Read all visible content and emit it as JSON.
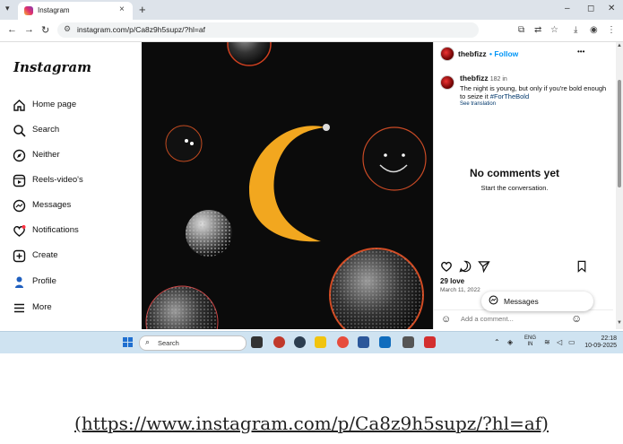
{
  "browser": {
    "tab_title": "Instagram",
    "tab_close": "×",
    "new_tab": "+",
    "address": "instagram.com/p/Ca8z9h5supz/?hl=af",
    "window_controls": [
      "–",
      "◻",
      "✕"
    ]
  },
  "sidebar": {
    "logo": "Instagram",
    "items": [
      {
        "label": "Home page",
        "icon": "home-icon"
      },
      {
        "label": "Search",
        "icon": "search-icon"
      },
      {
        "label": "Neither",
        "icon": "compass-icon"
      },
      {
        "label": "Reels-video's",
        "icon": "reels-icon"
      },
      {
        "label": "Messages",
        "icon": "messenger-icon"
      },
      {
        "label": "Notifications",
        "icon": "heart-icon"
      },
      {
        "label": "Create",
        "icon": "plus-square-icon"
      },
      {
        "label": "Profile",
        "icon": "profile-icon"
      },
      {
        "label": "More",
        "icon": "menu-icon"
      }
    ]
  },
  "post": {
    "username": "thebfizz",
    "follow_label": "• Follow",
    "more_label": "•••",
    "caption_user": "thebfizz",
    "caption_age": "182 in",
    "caption_text": "The night is young, but only if you're bold enough to seize it",
    "hashtag": "#ForTheBold",
    "see_translation": "See translation",
    "no_comments": "No comments yet",
    "start_conversation": "Start the conversation.",
    "likes": "29 love",
    "date": "March 11, 2022",
    "add_comment_placeholder": "Add a comment...",
    "messages_pill": "Messages"
  },
  "taskbar": {
    "search_label": "Search",
    "lang_top": "ENG",
    "lang_bottom": "IN",
    "time": "22:18",
    "date": "10-09-2025"
  },
  "source_url": "(https://www.instagram.com/p/Ca8z9h5supz/?hl=af)"
}
